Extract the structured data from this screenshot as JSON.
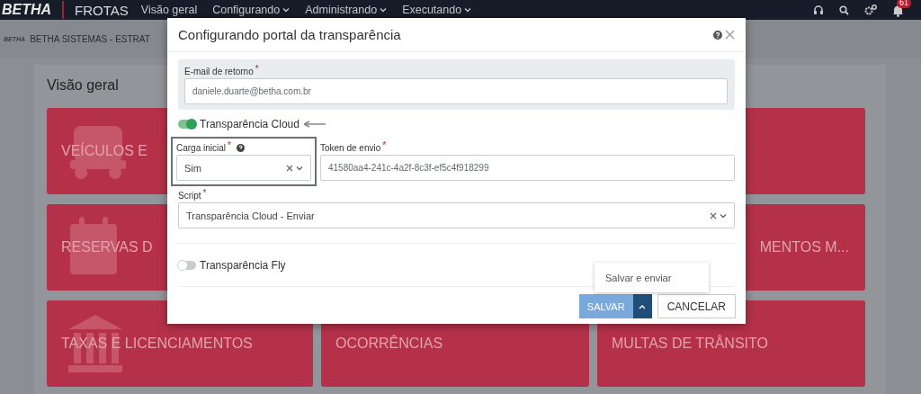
{
  "navbar": {
    "brand": "BETHA",
    "product": "FROTAS",
    "menu": [
      {
        "label": "Visão geral",
        "dropdown": false
      },
      {
        "label": "Configurando",
        "dropdown": true
      },
      {
        "label": "Administrando",
        "dropdown": true
      },
      {
        "label": "Executando",
        "dropdown": true
      }
    ],
    "notifications": "61"
  },
  "breadcrumb": {
    "logo": "BETHA",
    "text": "BETHA SISTEMAS - ESTRAT"
  },
  "overview": {
    "title": "Visão geral",
    "rows": [
      {
        "tiles": [
          {
            "kind": "label",
            "label": "VEÍCULOS E",
            "clipped": false
          },
          {
            "kind": "covered"
          }
        ]
      },
      {
        "tiles": [
          {
            "kind": "label",
            "label": "RESERVAS D",
            "clipped": false
          },
          {
            "kind": "label",
            "label": "MENTOS M...",
            "clipped": true
          }
        ]
      },
      {
        "tiles": [
          {
            "kind": "label",
            "label": "TAXAS E LICENCIAMENTOS",
            "clipped": false
          },
          {
            "kind": "label",
            "label": "OCORRÊNCIAS",
            "clipped": false
          },
          {
            "kind": "label",
            "label": "MULTAS DE TRÂNSITO",
            "clipped": false
          }
        ]
      }
    ]
  },
  "modal": {
    "title": "Configurando portal da transparência",
    "email": {
      "label": "E-mail de retorno",
      "required": "*",
      "value": "daniele.duarte@betha.com.br"
    },
    "cloud": {
      "label": "Transparência Cloud",
      "on": true
    },
    "carga": {
      "label": "Carga inicial",
      "required": "*",
      "value": "Sim",
      "highlighted": true
    },
    "token": {
      "label": "Token de envio",
      "required": "*",
      "value": "41580aa4-241c-4a2f-8c3f-ef5c4f918299"
    },
    "script": {
      "label": "Script",
      "required": "*",
      "value": "Transparência Cloud - Enviar"
    },
    "fly": {
      "label": "Transparência Fly",
      "on": false
    },
    "save": {
      "label": "SALVAR",
      "menu_open": true,
      "menu": [
        "Salvar e enviar"
      ]
    },
    "cancel": "CANCELAR"
  }
}
